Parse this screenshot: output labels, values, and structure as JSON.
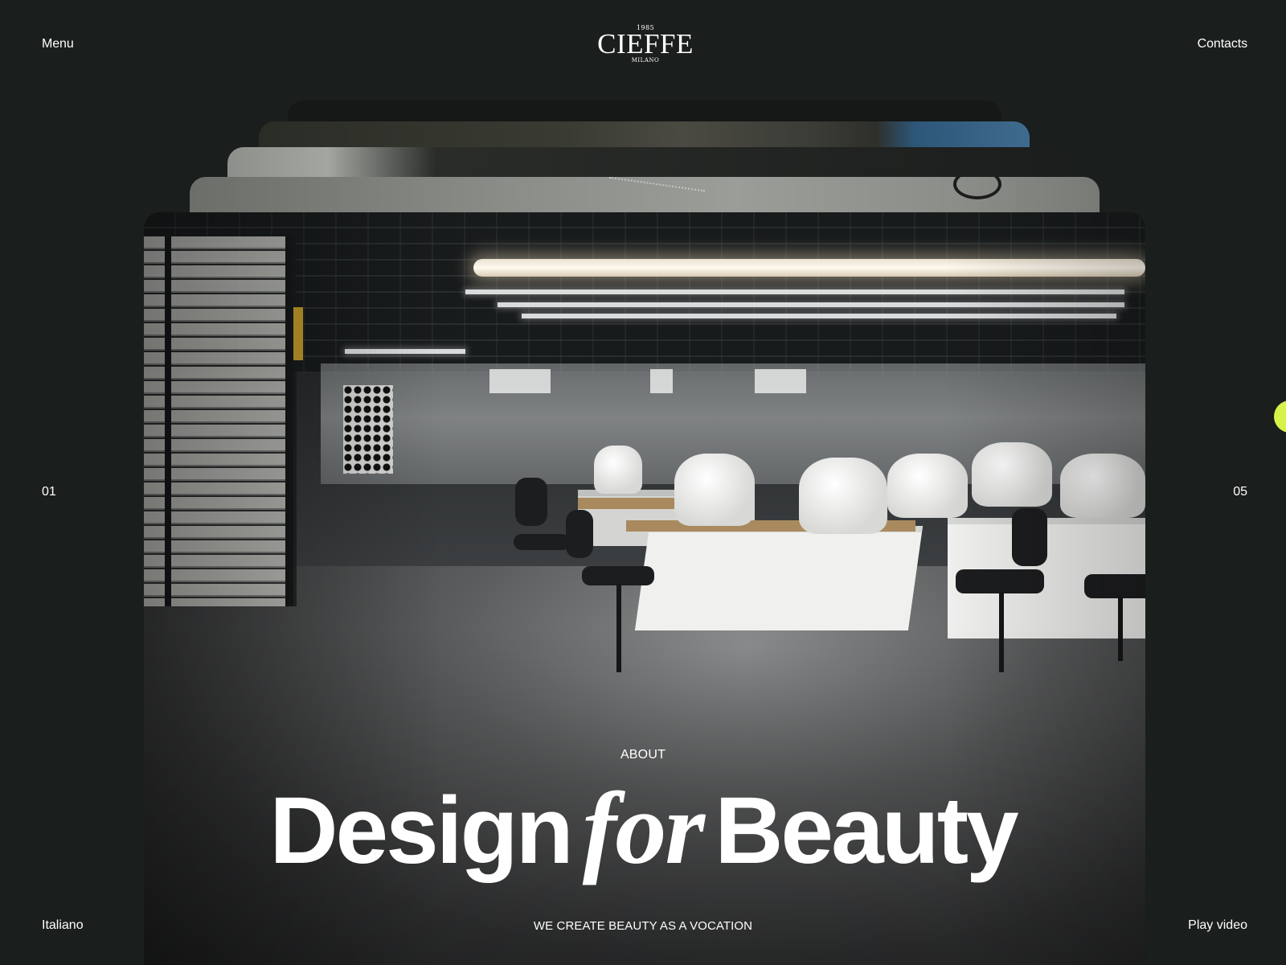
{
  "header": {
    "menu_label": "Menu",
    "contacts_label": "Contacts",
    "logo": {
      "year": "1985",
      "brand": "CIEFFE",
      "city": "MILANO"
    }
  },
  "slider": {
    "current": "01",
    "total": "05",
    "accent_color": "#d6f34a"
  },
  "footer": {
    "language_label": "Italiano",
    "play_video_label": "Play video"
  },
  "hero": {
    "eyebrow": "ABOUT",
    "headline_part1": "Design",
    "headline_italic": "for",
    "headline_part2": "Beauty",
    "tagline": "WE CREATE BEAUTY AS A VOCATION"
  },
  "colors": {
    "background": "#1a1e1c",
    "text": "#ffffff",
    "accent": "#d6f34a"
  }
}
